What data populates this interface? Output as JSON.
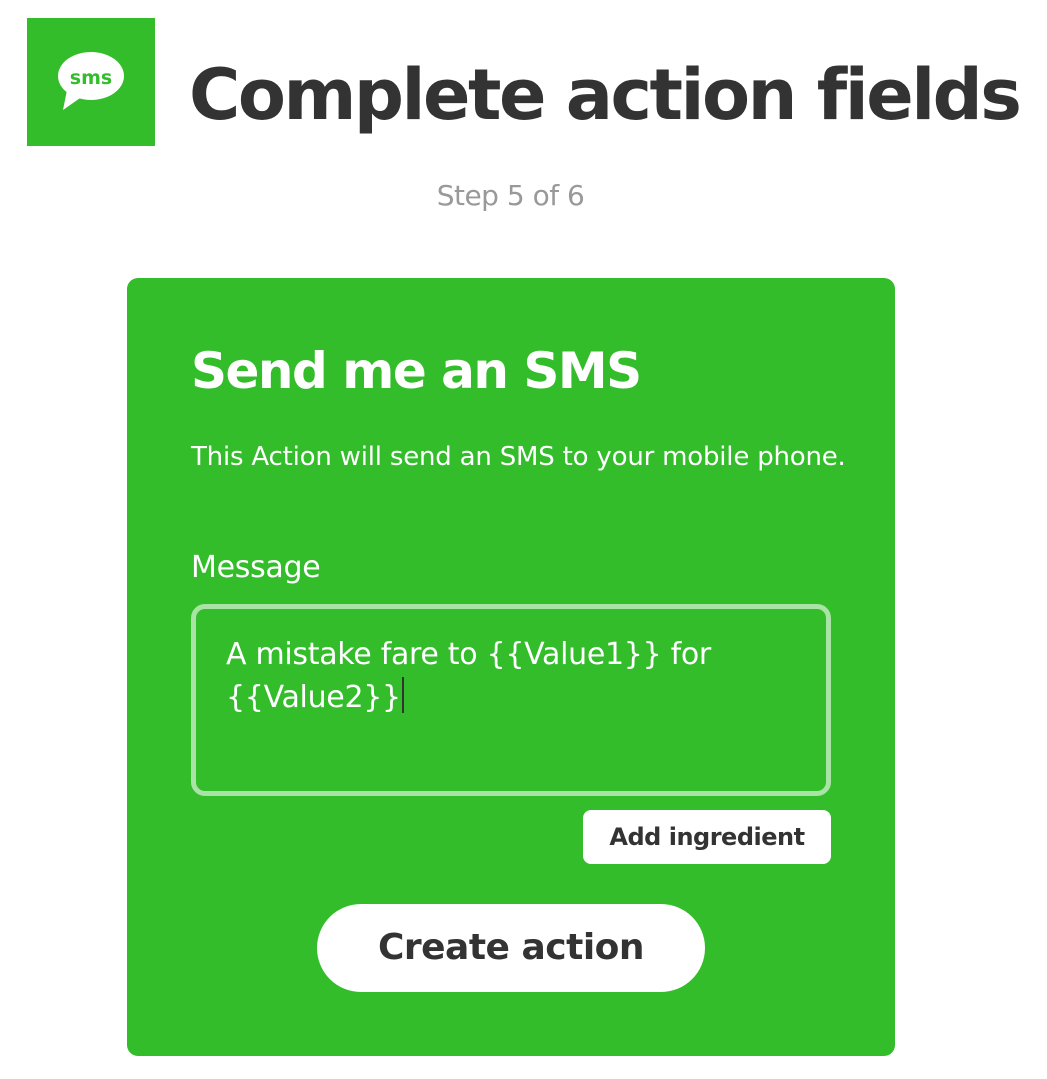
{
  "header": {
    "logo_icon": "sms-speech-bubble-icon",
    "logo_text": "sms",
    "title": "Complete action fields",
    "step": "Step 5 of 6"
  },
  "card": {
    "background": "#33bd2b",
    "title": "Send me an SMS",
    "description": "This Action will send an SMS to your mobile phone.",
    "message_label": "Message",
    "message_value": "A mistake fare to {{Value1}} for {{Value2}}",
    "add_ingredient_label": "Add ingredient",
    "create_action_label": "Create action"
  }
}
